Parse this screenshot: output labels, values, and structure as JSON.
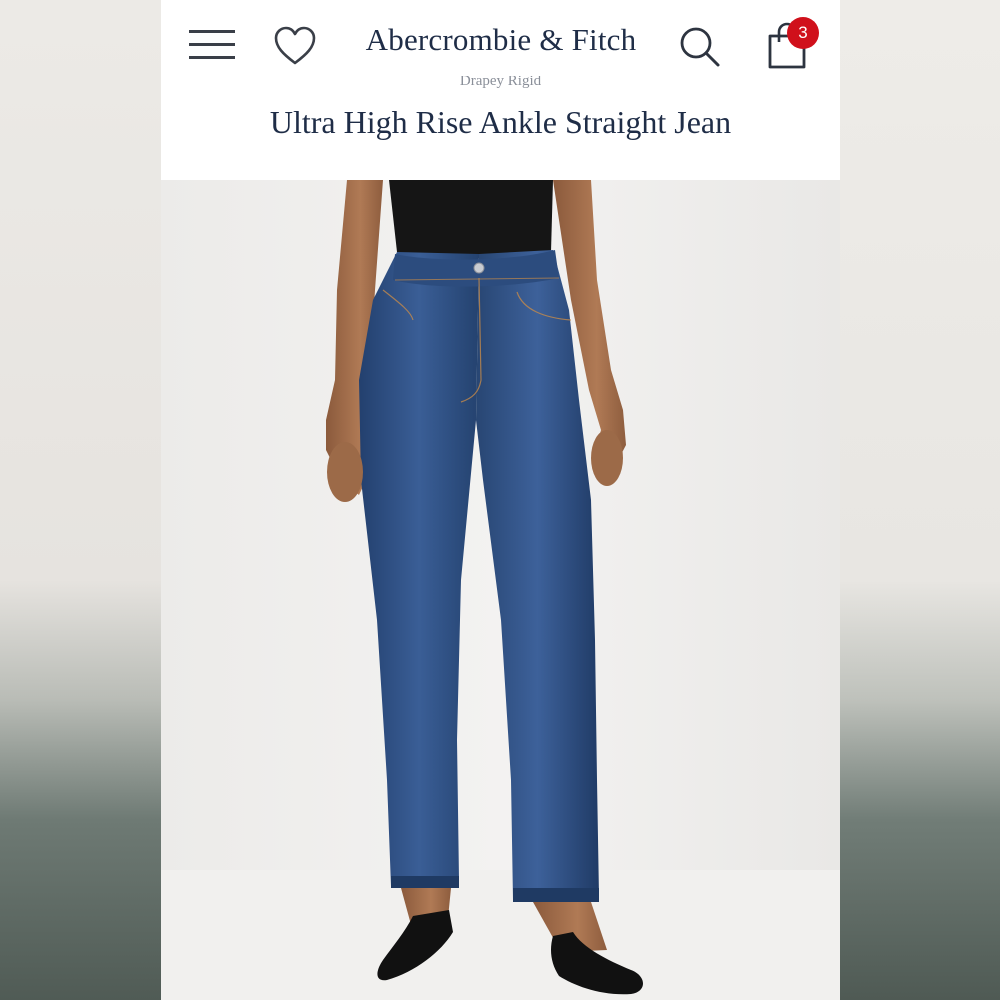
{
  "header": {
    "brand": "Abercrombie & Fitch",
    "subtag": "Drapey Rigid",
    "cart_count": "3",
    "icons": {
      "menu": "hamburger-menu-icon",
      "wishlist": "heart-icon",
      "search": "search-icon",
      "cart": "shopping-bag-icon"
    }
  },
  "product": {
    "title": "Ultra High Rise Ankle Straight Jean"
  },
  "colors": {
    "brand_navy": "#1f2d47",
    "badge_red": "#d0101b",
    "denim": "#2e4f83",
    "top": "#161616"
  }
}
